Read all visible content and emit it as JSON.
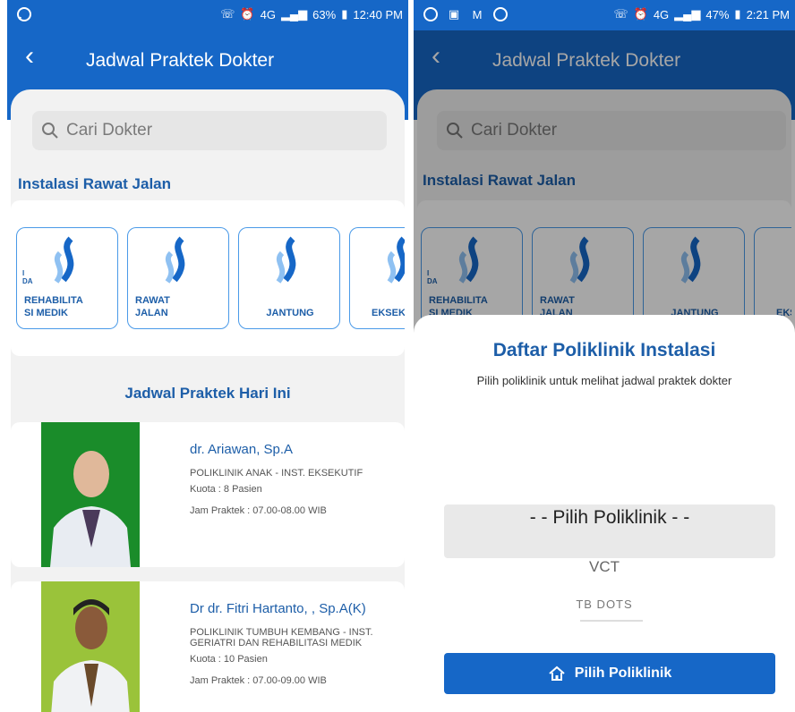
{
  "left": {
    "status": {
      "battery": "63%",
      "time": "12:40 PM",
      "network": "4G"
    },
    "header": {
      "back": "‹",
      "title": "Jadwal Praktek Dokter"
    },
    "search": {
      "placeholder": "Cari Dokter"
    },
    "section": "Instalasi Rawat Jalan",
    "poli_cards": [
      {
        "label": "REHABILITA\nSI MEDIK",
        "tiny": "I\nDA"
      },
      {
        "label": "RAWAT\nJALAN"
      },
      {
        "label": "JANTUNG"
      },
      {
        "label": "EKSEKUTIF"
      }
    ],
    "today_title": "Jadwal Praktek Hari Ini",
    "doctors": [
      {
        "name": "dr. Ariawan, Sp.A",
        "poli": "POLIKLINIK ANAK  - INST. EKSEKUTIF",
        "kuota": "Kuota : 8 Pasien",
        "jam": "Jam Praktek : 07.00-08.00 WIB"
      },
      {
        "name": "Dr dr. Fitri Hartanto, , Sp.A(K)",
        "poli": "POLIKLINIK TUMBUH KEMBANG - INST. GERIATRI DAN REHABILITASI MEDIK",
        "kuota": "Kuota : 10 Pasien",
        "jam": "Jam Praktek : 07.00-09.00 WIB"
      }
    ]
  },
  "right": {
    "status": {
      "battery": "47%",
      "time": "2:21 PM",
      "network": "4G"
    },
    "header": {
      "back": "‹",
      "title": "Jadwal Praktek Dokter"
    },
    "search": {
      "placeholder": "Cari Dokter"
    },
    "section": "Instalasi Rawat Jalan",
    "poli_cards": [
      {
        "label": "REHABILITA\nSI MEDIK",
        "tiny": "I\nDA"
      },
      {
        "label": "RAWAT\nJALAN"
      },
      {
        "label": "JANTUNG"
      },
      {
        "label": "EKS"
      }
    ],
    "modal": {
      "title": "Daftar Poliklinik Instalasi",
      "subtitle": "Pilih poliklinik untuk melihat jadwal praktek dokter",
      "selected": "- - Pilih Poliklinik - -",
      "options": [
        "VCT",
        "TB DOTS"
      ],
      "button": "Pilih Poliklinik"
    }
  },
  "colors": {
    "primary": "#1667c7",
    "accent_text": "#1d5ea8",
    "card_border": "#4a9ae8"
  }
}
